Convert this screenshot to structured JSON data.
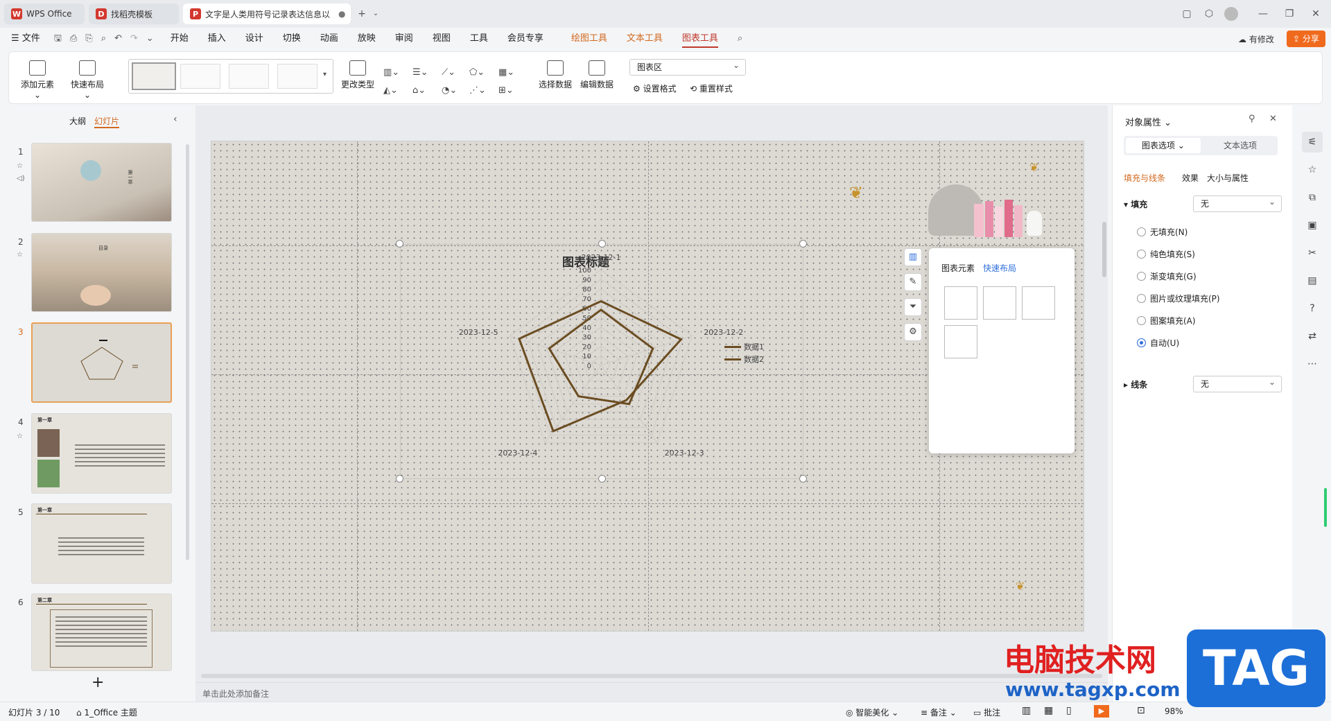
{
  "tabs": [
    {
      "label": "WPS Office",
      "color": "#d3382f"
    },
    {
      "label": "找稻壳模板",
      "color": "#d3382f"
    },
    {
      "label": "文字是人类用符号记录表达信息以",
      "color": "#d3382f"
    }
  ],
  "menu": {
    "file": "文件",
    "items": [
      "开始",
      "插入",
      "设计",
      "切换",
      "动画",
      "放映",
      "审阅",
      "视图",
      "工具",
      "会员专享"
    ],
    "context": [
      "绘图工具",
      "文本工具",
      "图表工具"
    ],
    "changes": "有修改",
    "share": "分享"
  },
  "ribbon": {
    "add_element": "添加元素",
    "quick_layout": "快速布局",
    "change_type": "更改类型",
    "select_data": "选择数据",
    "edit_data": "编辑数据",
    "area_select": "图表区",
    "set_format": "设置格式",
    "reset_style": "重置样式"
  },
  "left_panel": {
    "tab_outline": "大纲",
    "tab_slides": "幻灯片",
    "slides": [
      "1",
      "2",
      "3",
      "4",
      "5",
      "6"
    ],
    "thumb_heading_1": "第一章",
    "thumb_heading_2": "第二章",
    "thumb_toc": "目录",
    "add": "+"
  },
  "chart_data": {
    "type": "radar",
    "title": "图表标题",
    "categories": [
      "2023-12-1",
      "2023-12-2",
      "2023-12-3",
      "2023-12-4",
      "2023-12-5"
    ],
    "axis_ticks": [
      "0",
      "10",
      "20",
      "30",
      "40",
      "50",
      "60",
      "70",
      "80",
      "90",
      "100"
    ],
    "ylim": [
      0,
      100
    ],
    "series": [
      {
        "name": "数据1",
        "values": [
          67,
          88,
          45,
          85,
          90
        ]
      },
      {
        "name": "数据2",
        "values": [
          58,
          57,
          50,
          40,
          57
        ]
      }
    ],
    "legend": "right",
    "color": "#6b4d22"
  },
  "popup": {
    "tab_elements": "图表元素",
    "tab_layout": "快速布局"
  },
  "right_panel": {
    "title": "对象属性",
    "tab_chart": "图表选项",
    "tab_text": "文本选项",
    "subtab_fill": "填充与线条",
    "subtab_effect": "效果",
    "subtab_size": "大小与属性",
    "fill_label": "填充",
    "fill_value": "无",
    "options": [
      "无填充(N)",
      "纯色填充(S)",
      "渐变填充(G)",
      "图片或纹理填充(P)",
      "图案填充(A)",
      "自动(U)"
    ],
    "line_label": "线条",
    "line_value": "无"
  },
  "notes_placeholder": "单击此处添加备注",
  "status": {
    "slide_count": "幻灯片 3 / 10",
    "theme": "1_Office 主题",
    "beautify": "智能美化",
    "notes": "备注",
    "comments": "批注",
    "zoom": "98%"
  },
  "watermark": {
    "site_cn": "电脑技术网",
    "site_url": "www.tagxp.com",
    "tag": "TAG"
  }
}
